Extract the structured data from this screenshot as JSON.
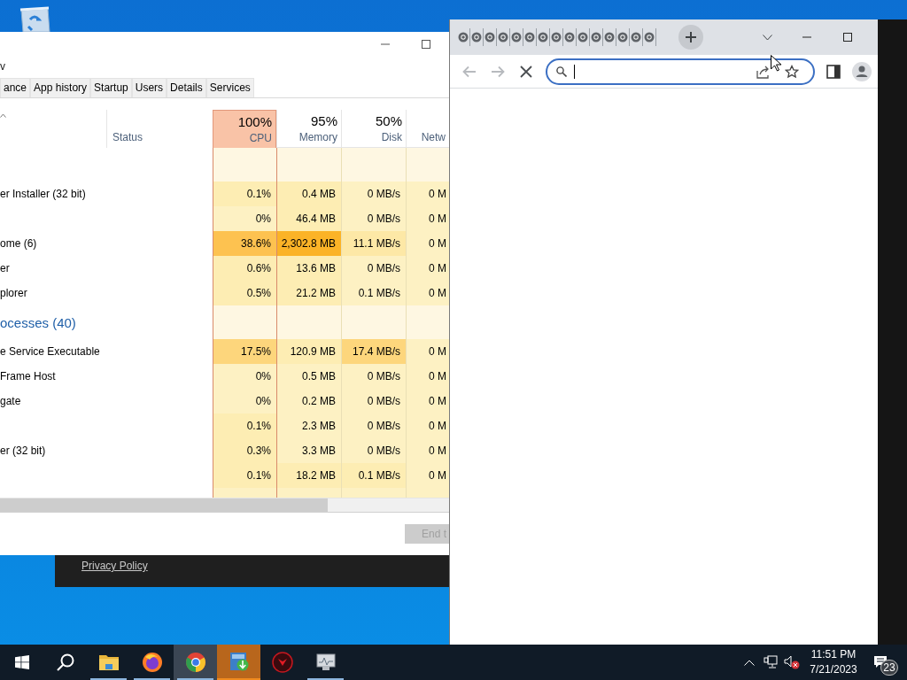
{
  "desktop": {
    "panel": {
      "link": "Privacy Policy"
    }
  },
  "task_manager": {
    "menu": [
      {
        "label": "v"
      }
    ],
    "tabs": [
      {
        "label": "ance",
        "selected": false
      },
      {
        "label": "App history",
        "selected": false
      },
      {
        "label": "Startup",
        "selected": false
      },
      {
        "label": "Users",
        "selected": false
      },
      {
        "label": "Details",
        "selected": false
      },
      {
        "label": "Services",
        "selected": false
      }
    ],
    "name_header": {
      "sorted": true
    },
    "status_header": {
      "label": "Status"
    },
    "columns": [
      {
        "kind": "meter",
        "percent": "100%",
        "label": "CPU",
        "color": "#f9c3a7"
      },
      {
        "kind": "meter",
        "percent": "95%",
        "label": "Memory"
      },
      {
        "kind": "meter",
        "percent": "50%",
        "label": "Disk"
      },
      {
        "kind": "meter",
        "label": "Netw"
      }
    ],
    "rows": [
      {
        "kind": "group",
        "cells": [
          {
            "color": "#fef7e2"
          },
          {
            "color": "#fef7e2"
          },
          {
            "color": "#fef7e2"
          },
          {
            "color": "#fef7e2"
          }
        ]
      },
      {
        "kind": "process",
        "name": "er Installer (32 bit)",
        "cells": [
          {
            "text": "0.1%",
            "color": "#fdedb3"
          },
          {
            "text": "0.4 MB",
            "color": "#fdedb3"
          },
          {
            "text": "0 MB/s",
            "color": "#fdf1c3"
          },
          {
            "text": "0 M",
            "color": "#fdf1c3"
          }
        ]
      },
      {
        "kind": "process",
        "name": "",
        "cells": [
          {
            "text": "0%",
            "color": "#fdf1c3"
          },
          {
            "text": "46.4 MB",
            "color": "#fdedb3"
          },
          {
            "text": "0 MB/s",
            "color": "#fdf1c3"
          },
          {
            "text": "0 M",
            "color": "#fdf1c3"
          }
        ]
      },
      {
        "kind": "process",
        "name": "ome (6)",
        "cells": [
          {
            "text": "38.6%",
            "color": "#fdc250"
          },
          {
            "text": "2,302.8 MB",
            "color": "#fbb327"
          },
          {
            "text": "11.1 MB/s",
            "color": "#fde8a6"
          },
          {
            "text": "0 M",
            "color": "#fdf1c3"
          }
        ]
      },
      {
        "kind": "process",
        "name": "er",
        "cells": [
          {
            "text": "0.6%",
            "color": "#fdedb3"
          },
          {
            "text": "13.6 MB",
            "color": "#fdedb3"
          },
          {
            "text": "0 MB/s",
            "color": "#fdf1c3"
          },
          {
            "text": "0 M",
            "color": "#fdf1c3"
          }
        ]
      },
      {
        "kind": "process",
        "name": "plorer",
        "cells": [
          {
            "text": "0.5%",
            "color": "#fdedb3"
          },
          {
            "text": "21.2 MB",
            "color": "#fdedb3"
          },
          {
            "text": "0.1 MB/s",
            "color": "#fdf1c3"
          },
          {
            "text": "0 M",
            "color": "#fdf1c3"
          }
        ]
      },
      {
        "kind": "group",
        "name": "ocesses (40)",
        "cells": [
          {
            "color": "#fef7e2"
          },
          {
            "color": "#fef7e2"
          },
          {
            "color": "#fef7e2"
          },
          {
            "color": "#fef7e2"
          }
        ]
      },
      {
        "kind": "process",
        "name": "e Service Executable",
        "cells": [
          {
            "text": "17.5%",
            "color": "#fdd67c"
          },
          {
            "text": "120.9 MB",
            "color": "#fdedb3"
          },
          {
            "text": "17.4 MB/s",
            "color": "#fdd67c"
          },
          {
            "text": "0 M",
            "color": "#fdf1c3"
          }
        ]
      },
      {
        "kind": "process",
        "name": "Frame Host",
        "cells": [
          {
            "text": "0%",
            "color": "#fdf1c3"
          },
          {
            "text": "0.5 MB",
            "color": "#fdf1c3"
          },
          {
            "text": "0 MB/s",
            "color": "#fdf1c3"
          },
          {
            "text": "0 M",
            "color": "#fdf1c3"
          }
        ]
      },
      {
        "kind": "process",
        "name": "gate",
        "cells": [
          {
            "text": "0%",
            "color": "#fdf1c3"
          },
          {
            "text": "0.2 MB",
            "color": "#fdf1c3"
          },
          {
            "text": "0 MB/s",
            "color": "#fdf1c3"
          },
          {
            "text": "0 M",
            "color": "#fdf1c3"
          }
        ]
      },
      {
        "kind": "process",
        "name": "",
        "cells": [
          {
            "text": "0.1%",
            "color": "#fdedb3"
          },
          {
            "text": "2.3 MB",
            "color": "#fdf1c3"
          },
          {
            "text": "0 MB/s",
            "color": "#fdf1c3"
          },
          {
            "text": "0 M",
            "color": "#fdf1c3"
          }
        ]
      },
      {
        "kind": "process",
        "name": "er (32 bit)",
        "cells": [
          {
            "text": "0.3%",
            "color": "#fdedb3"
          },
          {
            "text": "3.3 MB",
            "color": "#fdf1c3"
          },
          {
            "text": "0 MB/s",
            "color": "#fdf1c3"
          },
          {
            "text": "0 M",
            "color": "#fdf1c3"
          }
        ]
      },
      {
        "kind": "process",
        "name": "",
        "cells": [
          {
            "text": "0.1%",
            "color": "#fdedb3"
          },
          {
            "text": "18.2 MB",
            "color": "#fdedb3"
          },
          {
            "text": "0.1 MB/s",
            "color": "#fdedb3"
          },
          {
            "text": "0 M",
            "color": "#fdf1c3"
          }
        ]
      },
      {
        "kind": "process",
        "name": "",
        "cells": [
          {
            "color": "#fdf1c3"
          },
          {
            "color": "#fdf1c3"
          },
          {
            "color": "#fdf1c3"
          },
          {
            "color": "#fdf1c3"
          }
        ]
      }
    ],
    "end_task": {
      "label": "End t",
      "disabled": true
    }
  },
  "browser": {
    "tabs": [
      {
        "kind": "favicon"
      },
      {
        "kind": "favicon"
      },
      {
        "kind": "favicon"
      },
      {
        "kind": "favicon"
      },
      {
        "kind": "favicon"
      },
      {
        "kind": "favicon"
      },
      {
        "kind": "favicon"
      },
      {
        "kind": "favicon"
      },
      {
        "kind": "favicon"
      },
      {
        "kind": "favicon"
      },
      {
        "kind": "favicon"
      },
      {
        "kind": "favicon"
      },
      {
        "kind": "favicon"
      },
      {
        "kind": "favicon"
      },
      {
        "kind": "favicon"
      }
    ],
    "nav": [
      {
        "kind": "back",
        "disabled": true
      },
      {
        "kind": "forward",
        "disabled": true
      },
      {
        "kind": "stop",
        "disabled": false
      }
    ],
    "omnibox": {
      "focused": true
    }
  },
  "taskbar": {
    "apps": [
      {
        "kind": "explorer",
        "running": true,
        "active": false,
        "flashing": false
      },
      {
        "kind": "firefox",
        "running": true,
        "active": false,
        "flashing": false
      },
      {
        "kind": "chrome",
        "running": true,
        "active": true,
        "flashing": false
      },
      {
        "kind": "installer",
        "running": false,
        "active": false,
        "flashing": true
      },
      {
        "kind": "red-app",
        "running": false,
        "active": false,
        "flashing": false
      },
      {
        "kind": "monitor",
        "running": true,
        "active": false,
        "flashing": false
      }
    ],
    "volume": {
      "muted": true
    },
    "clock": {
      "time": "11:51 PM",
      "date": "7/21/2023"
    },
    "notifications": {
      "count": "23"
    }
  }
}
